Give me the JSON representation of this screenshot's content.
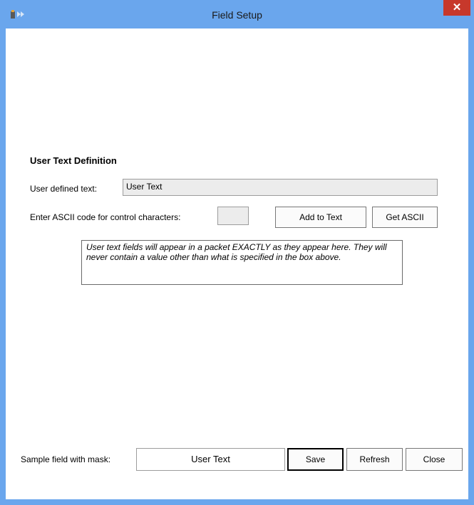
{
  "window": {
    "title": "Field Setup",
    "close_glyph": "✕"
  },
  "section": {
    "title": "User Text Definition"
  },
  "user_text": {
    "label": "User defined text:",
    "value": "User Text"
  },
  "ascii": {
    "label": "Enter ASCII code for control characters:",
    "value": "",
    "add_button": "Add to Text",
    "get_button": "Get ASCII"
  },
  "info": {
    "text": "User text fields will appear in a packet EXACTLY as they appear here.  They will never contain a value other than what is specified in the box above."
  },
  "footer": {
    "sample_label": "Sample field with mask:",
    "sample_value": "User Text",
    "save_button": "Save",
    "refresh_button": "Refresh",
    "close_button": "Close"
  },
  "colors": {
    "titlebar": "#6aa6ed",
    "close": "#c7382b"
  }
}
